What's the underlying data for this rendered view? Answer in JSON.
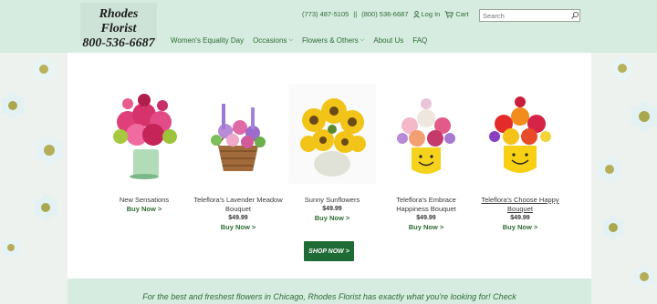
{
  "header": {
    "logo_line1": "Rhodes Florist",
    "logo_line2": "800-536-6687",
    "phone_local": "(773) 487-5105",
    "separator": "||",
    "phone_tollfree": "(800) 536-6687",
    "login_label": "Log In",
    "cart_label": "Cart",
    "search_placeholder": "Search"
  },
  "nav": [
    {
      "label": "Women's Equality Day",
      "dropdown": false
    },
    {
      "label": "Occasions",
      "dropdown": true
    },
    {
      "label": "Flowers & Others",
      "dropdown": true
    },
    {
      "label": "About Us",
      "dropdown": false
    },
    {
      "label": "FAQ",
      "dropdown": false
    }
  ],
  "products": [
    {
      "name": "New Sensations",
      "price": "",
      "buy": "Buy Now >"
    },
    {
      "name": "Teleflora's Lavender Meadow Bouquet",
      "price": "$49.99",
      "buy": "Buy Now >"
    },
    {
      "name": "Sunny Sunflowers",
      "price": "$49.99",
      "buy": "Buy Now >"
    },
    {
      "name": "Teleflora's Embrace Happiness Bouquet",
      "price": "$49.99",
      "buy": "Buy Now >"
    },
    {
      "name": "Teleflora's Choose Happy Bouquet",
      "price": "$49.99",
      "buy": "Buy Now >"
    }
  ],
  "shop_now": "SHOP NOW >",
  "promo_text": "For the best and freshest flowers in Chicago, Rhodes Florist has exactly what you're looking for! Check",
  "colors": {
    "brand_green": "#2e6b34",
    "header_bg": "#d6ece1",
    "button_bg": "#1f6b35"
  }
}
